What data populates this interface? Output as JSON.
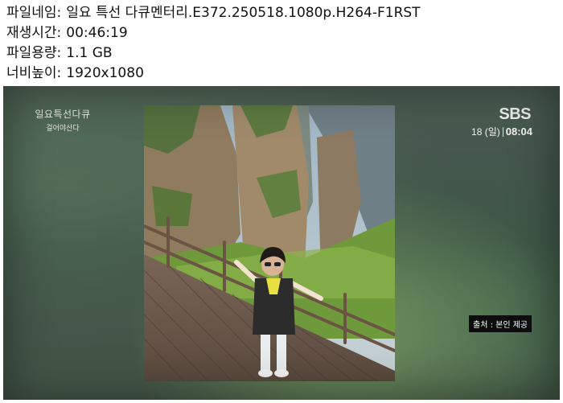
{
  "file_info": {
    "rows": [
      {
        "label": "파일네임:",
        "value": "일요 특선 다큐멘터리.E372.250518.1080p.H264-F1RST"
      },
      {
        "label": "재생시간:",
        "value": "00:46:19"
      },
      {
        "label": "파일용량:",
        "value": "1.1 GB"
      },
      {
        "label": "너비높이:",
        "value": "1920x1080"
      }
    ]
  },
  "broadcast": {
    "program_title": "일요특선다큐",
    "program_subtitle": "걸어야산다",
    "channel_logo": "SBS",
    "date": "18 (일)",
    "time": "08:04",
    "caption": "출처 : 본인 제공"
  },
  "colors": {
    "background": "#ffffff",
    "frame_background": "#4c5e52",
    "caption_background": "#0d0d0d"
  }
}
